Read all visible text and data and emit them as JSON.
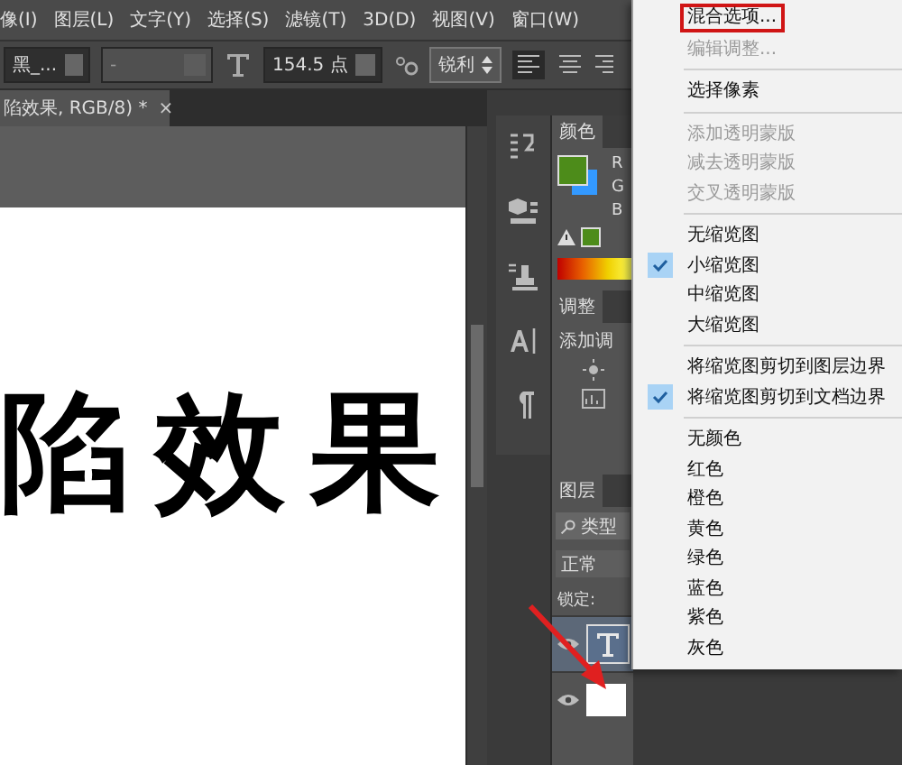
{
  "menu_bar": [
    "像(I)",
    "图层(L)",
    "文字(Y)",
    "选择(S)",
    "滤镜(T)",
    "3D(D)",
    "视图(V)",
    "窗口(W)"
  ],
  "options_bar": {
    "font_family": "黑_...",
    "font_style": "-",
    "font_size": "154.5 点",
    "antialias": "锐利"
  },
  "document_tab": {
    "title": "陷效果, RGB/8) *",
    "close": "×"
  },
  "canvas": {
    "text": "陷效果"
  },
  "color_panel": {
    "tab": "颜色",
    "channels": [
      "R",
      "G",
      "B"
    ]
  },
  "adjustments_panel": {
    "tab": "调整",
    "label": "添加调"
  },
  "layers_panel": {
    "tab": "图层",
    "filter": "类型",
    "blend_mode": "正常",
    "lock_label": "锁定:",
    "layers": [
      {
        "kind": "text",
        "visible": true,
        "selected": true
      },
      {
        "kind": "image",
        "visible": true,
        "selected": false
      }
    ]
  },
  "context_menu": {
    "groups": [
      [
        {
          "label": "混合选项...",
          "disabled": false,
          "checked": false,
          "annotated": true
        },
        {
          "label": "编辑调整...",
          "disabled": true,
          "checked": false,
          "annotated": false
        }
      ],
      [
        {
          "label": "选择像素",
          "disabled": false,
          "checked": false,
          "annotated": false
        }
      ],
      [
        {
          "label": "添加透明蒙版",
          "disabled": true,
          "checked": false,
          "annotated": false
        },
        {
          "label": "减去透明蒙版",
          "disabled": true,
          "checked": false,
          "annotated": false
        },
        {
          "label": "交叉透明蒙版",
          "disabled": true,
          "checked": false,
          "annotated": false
        }
      ],
      [
        {
          "label": "无缩览图",
          "disabled": false,
          "checked": false,
          "annotated": false
        },
        {
          "label": "小缩览图",
          "disabled": false,
          "checked": true,
          "annotated": false
        },
        {
          "label": "中缩览图",
          "disabled": false,
          "checked": false,
          "annotated": false
        },
        {
          "label": "大缩览图",
          "disabled": false,
          "checked": false,
          "annotated": false
        }
      ],
      [
        {
          "label": "将缩览图剪切到图层边界",
          "disabled": false,
          "checked": false,
          "annotated": false
        },
        {
          "label": "将缩览图剪切到文档边界",
          "disabled": false,
          "checked": true,
          "annotated": false
        }
      ],
      [
        {
          "label": "无颜色",
          "disabled": false,
          "checked": false,
          "annotated": false
        },
        {
          "label": "红色",
          "disabled": false,
          "checked": false,
          "annotated": false
        },
        {
          "label": "橙色",
          "disabled": false,
          "checked": false,
          "annotated": false
        },
        {
          "label": "黄色",
          "disabled": false,
          "checked": false,
          "annotated": false
        },
        {
          "label": "绿色",
          "disabled": false,
          "checked": false,
          "annotated": false
        },
        {
          "label": "蓝色",
          "disabled": false,
          "checked": false,
          "annotated": false
        },
        {
          "label": "紫色",
          "disabled": false,
          "checked": false,
          "annotated": false
        },
        {
          "label": "灰色",
          "disabled": false,
          "checked": false,
          "annotated": false
        }
      ]
    ]
  }
}
